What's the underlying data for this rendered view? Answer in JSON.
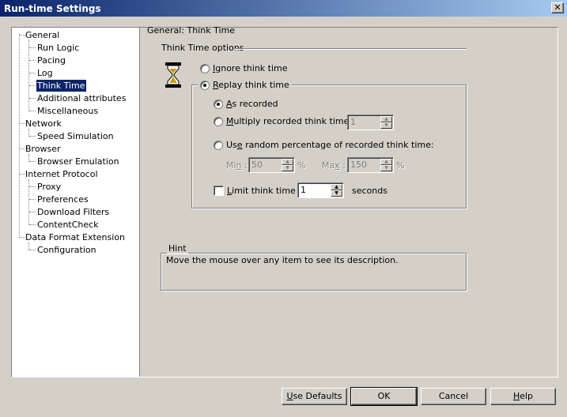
{
  "window": {
    "title": "Run-time Settings",
    "close_glyph": "✕"
  },
  "tree": {
    "items": [
      {
        "label": "General",
        "level": 0
      },
      {
        "label": "Run Logic",
        "level": 1
      },
      {
        "label": "Pacing",
        "level": 1
      },
      {
        "label": "Log",
        "level": 1
      },
      {
        "label": "Think Time",
        "level": 1,
        "selected": true
      },
      {
        "label": "Additional attributes",
        "level": 1
      },
      {
        "label": "Miscellaneous",
        "level": 1
      },
      {
        "label": "Network",
        "level": 0
      },
      {
        "label": "Speed Simulation",
        "level": 1
      },
      {
        "label": "Browser",
        "level": 0
      },
      {
        "label": "Browser Emulation",
        "level": 1
      },
      {
        "label": "Internet Protocol",
        "level": 0
      },
      {
        "label": "Proxy",
        "level": 1
      },
      {
        "label": "Preferences",
        "level": 1
      },
      {
        "label": "Download Filters",
        "level": 1
      },
      {
        "label": "ContentCheck",
        "level": 1
      },
      {
        "label": "Data Format Extension",
        "level": 0
      },
      {
        "label": "Configuration",
        "level": 1
      }
    ]
  },
  "panel": {
    "header": "General: Think Time",
    "section": "Think Time options",
    "ignore": {
      "pre": "",
      "key": "I",
      "post": "gnore think time",
      "checked": false
    },
    "replay": {
      "pre": "",
      "key": "R",
      "post": "eplay think time",
      "checked": true
    },
    "as_recorded": {
      "pre": "",
      "key": "A",
      "post": "s recorded",
      "checked": true
    },
    "multiply": {
      "pre": "",
      "key": "M",
      "post": "ultiply recorded think time by:",
      "checked": false,
      "value": "1"
    },
    "random": {
      "pre": "Us",
      "key": "e",
      "post": " random percentage of recorded think time:",
      "checked": false
    },
    "min": {
      "pre": "Mi",
      "key": "n",
      "post": " :",
      "value": "50",
      "unit": "%"
    },
    "max": {
      "pre": "Ma",
      "key": "x",
      "post": " :",
      "value": "150",
      "unit": "%"
    },
    "limit": {
      "pre": "",
      "key": "L",
      "post": "imit think time to:",
      "checked": false,
      "value": "1",
      "unit": "seconds"
    },
    "hint": {
      "title": "Hint",
      "text": "Move the mouse over any item to see its description."
    }
  },
  "buttons": {
    "defaults": {
      "pre": "",
      "key": "U",
      "post": "se Defaults"
    },
    "ok": "OK",
    "cancel": "Cancel",
    "help": {
      "pre": "",
      "key": "H",
      "post": "elp"
    }
  },
  "colors": {
    "titlebar_start": "#0a246a",
    "titlebar_end": "#a6caf0",
    "face": "#d4d0c8",
    "selection": "#0a246a"
  },
  "icons": {
    "think_time": "hourglass-icon"
  }
}
